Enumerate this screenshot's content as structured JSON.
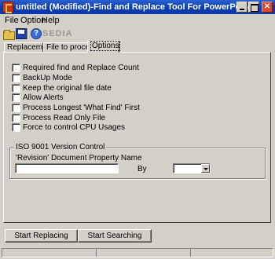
{
  "window": {
    "title": "untitled (Modified)-Find and Replace Tool For PowerPoint",
    "minimize_glyph": "",
    "maximize_glyph": "",
    "close_glyph": "✕"
  },
  "menu": [
    "File",
    "Option",
    "Help"
  ],
  "toolbar": {
    "icons": [
      "open-folder-icon",
      "save-disk-icon",
      "help-icon"
    ],
    "help_glyph": "?",
    "logo_text": "SEDIA"
  },
  "tabs": [
    {
      "label": "Replacement",
      "active": false
    },
    {
      "label": "File to process",
      "active": false
    },
    {
      "label": "Options",
      "active": true
    }
  ],
  "options": [
    {
      "label": "Required find and Replace Count",
      "checked": false
    },
    {
      "label": "BackUp Mode",
      "checked": false
    },
    {
      "label": "Keep the original file date",
      "checked": false
    },
    {
      "label": "Allow Alerts",
      "checked": false
    },
    {
      "label": "Process Longest 'What Find' First",
      "checked": false
    },
    {
      "label": "Process Read Only File",
      "checked": false
    },
    {
      "label": "Force to control CPU Usages",
      "checked": false
    }
  ],
  "iso": {
    "group_title": "ISO 9001 Version Control",
    "property_label": "'Revision' Document  Property Name",
    "property_value": "",
    "by_label": "By",
    "by_value": ""
  },
  "buttons": {
    "start_replacing": "Start Replacing",
    "start_searching": "Start Searching"
  }
}
